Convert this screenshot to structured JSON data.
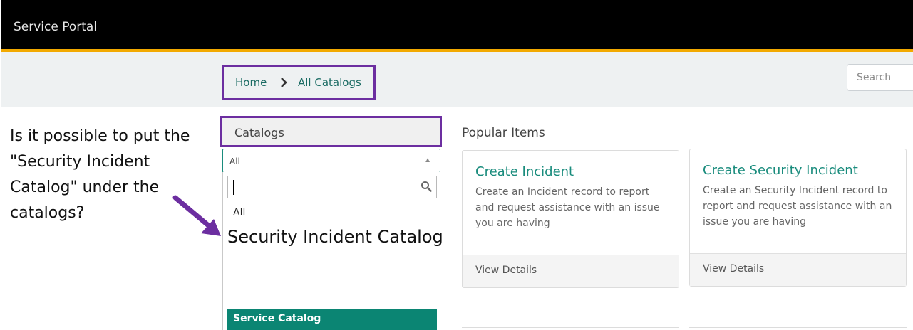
{
  "header": {
    "brand": "Service Portal"
  },
  "breadcrumb": {
    "home": "Home",
    "current": "All Catalogs"
  },
  "search": {
    "placeholder": "Search"
  },
  "annotation": {
    "question": "Is it possible to put the \"Security Incident Catalog\" under the catalogs?"
  },
  "catalogs": {
    "heading": "Catalogs",
    "selected": "All",
    "options": {
      "all": "All",
      "security": "Security Incident Catalog",
      "service": "Service Catalog"
    }
  },
  "popular": {
    "title": "Popular Items",
    "cards": [
      {
        "title": "Create Incident",
        "description": "Create an Incident record to report and request assistance with an issue you are having",
        "action": "View Details"
      },
      {
        "title": "Create Security Incident",
        "description": "Create an Security Incident record to report and request assistance with an issue you are having",
        "action": "View Details"
      }
    ]
  },
  "colors": {
    "highlight_border": "#6c2ea0",
    "accent_stripe": "#f2a900",
    "link_teal": "#1a8c7d",
    "selected_option": "#0b8573"
  },
  "icons": {
    "breadcrumb_separator": "chevron-right-icon",
    "dropdown_caret": "caret-up-icon",
    "dropdown_search": "magnifier-icon",
    "annotation": "arrow-icon"
  }
}
